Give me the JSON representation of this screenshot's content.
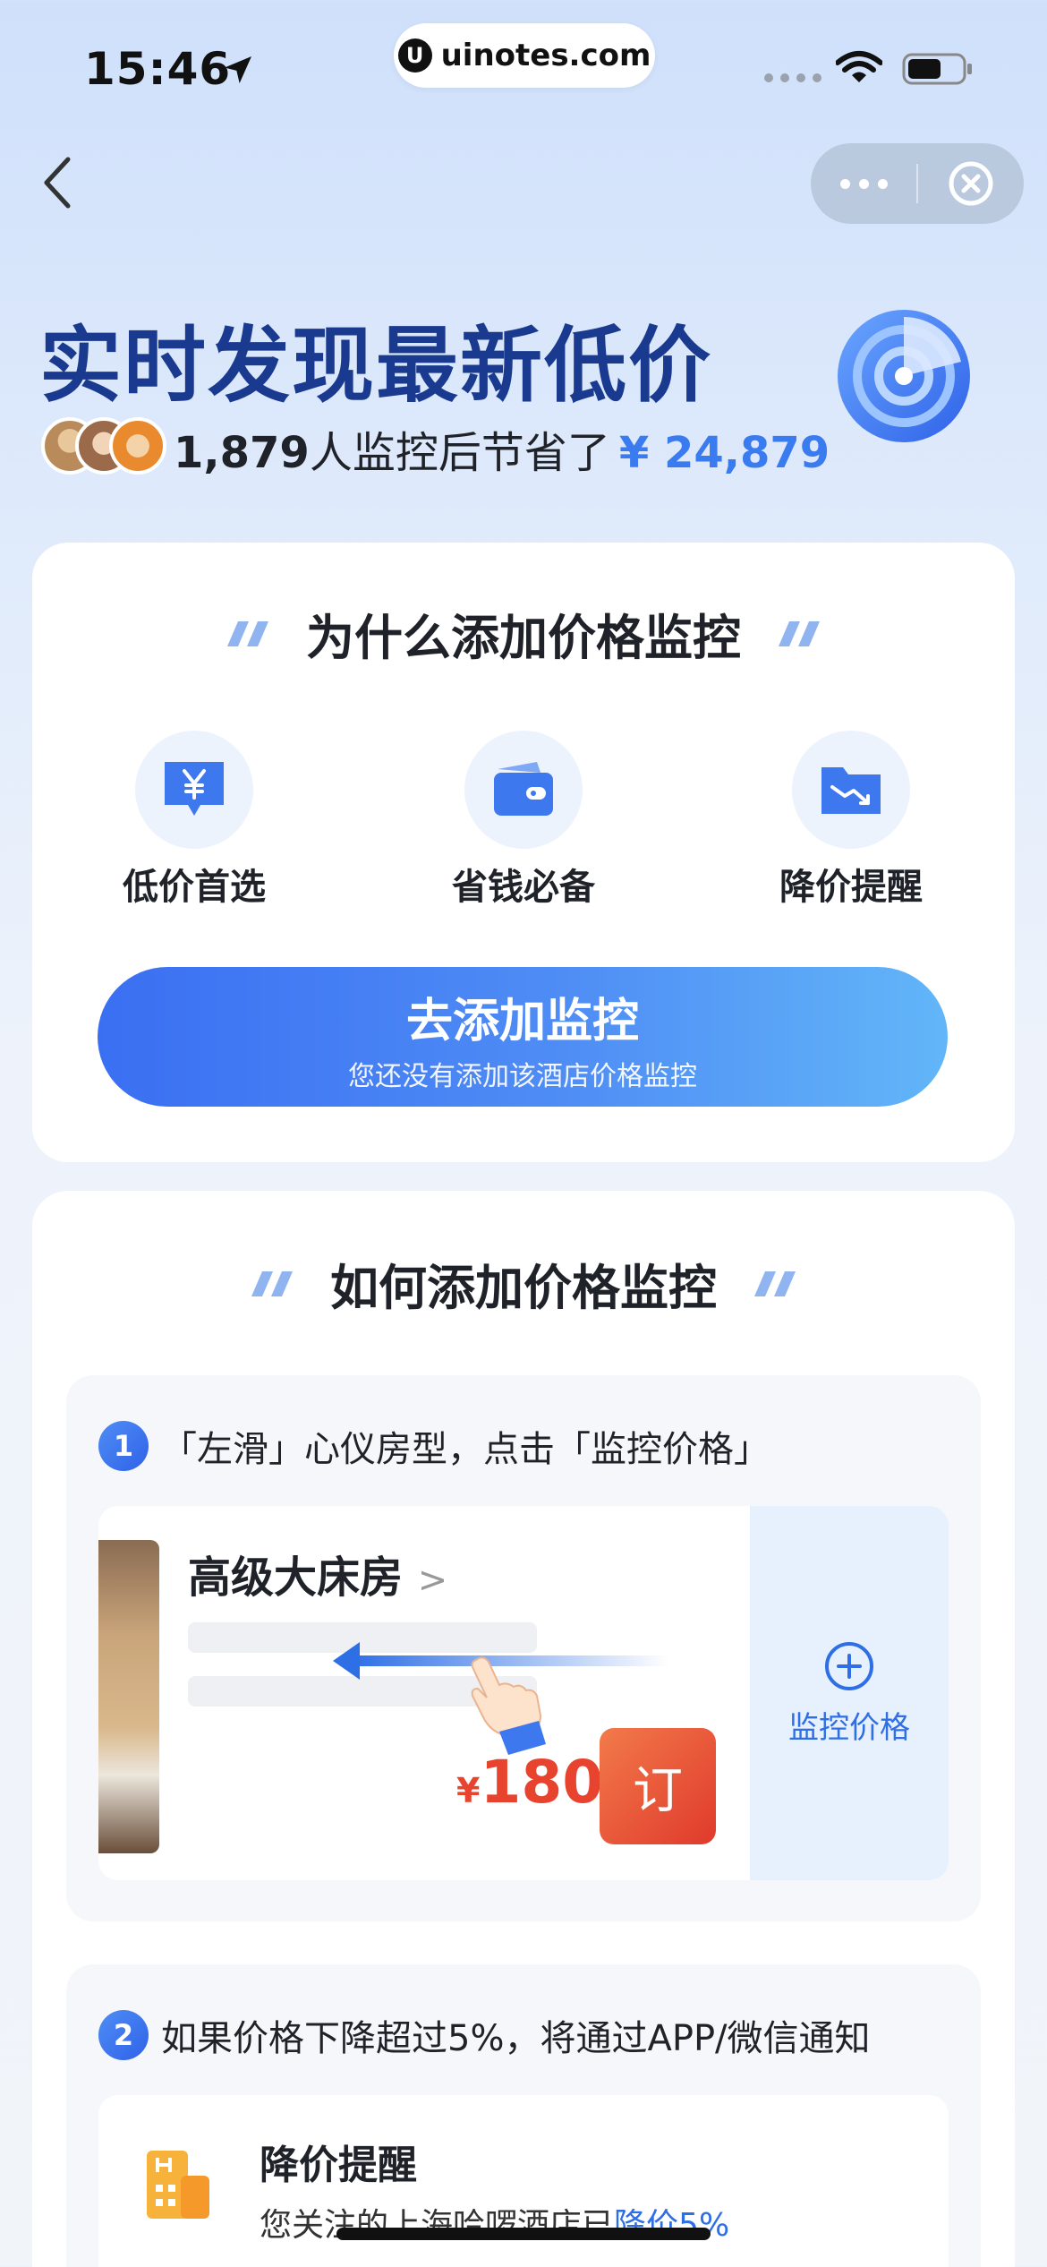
{
  "status_bar": {
    "time": "15:46",
    "url": "uinotes.com",
    "url_logo": "U",
    "icons": [
      "location-arrow-icon",
      "cellular-signal-icon",
      "wifi-icon",
      "battery-icon"
    ]
  },
  "nav": {
    "back_icon": "chevron-left-icon",
    "more_icon": "more-dots-icon",
    "close_icon": "close-circle-icon"
  },
  "hero": {
    "title": "实时发现最新低价",
    "saved_count": "1,879",
    "saved_text": "人监控后节省了",
    "saved_amount": "¥ 24,879",
    "radar_icon": "radar-icon"
  },
  "why": {
    "title": "为什么添加价格监控",
    "features": [
      {
        "label": "低价首选",
        "icon": "yen-chat-icon"
      },
      {
        "label": "省钱必备",
        "icon": "wallet-icon"
      },
      {
        "label": "降价提醒",
        "icon": "price-drop-folder-icon"
      }
    ],
    "cta_main": "去添加监控",
    "cta_sub": "您还没有添加该酒店价格监控"
  },
  "how": {
    "title": "如何添加价格监控",
    "step1": {
      "num": "1",
      "text": "「左滑」心仪房型，点击「监控价格」",
      "room_name": "高级大床房",
      "chevron": ">",
      "price_currency": "¥",
      "price": "180",
      "book_label": "订",
      "monitor_label": "监控价格"
    },
    "step2": {
      "num": "2",
      "text": "如果价格下降超过5%，将通过APP/微信通知",
      "notify_title": "降价提醒",
      "notify_body_prefix": "您关注的",
      "notify_body_hotel": "上海哈啰酒店",
      "notify_body_mid": "已",
      "notify_body_highlight": "降价5%"
    }
  },
  "colors": {
    "title_navy": "#1a3a8f",
    "accent_blue": "#3a7bf0",
    "price_red": "#e8432f"
  }
}
